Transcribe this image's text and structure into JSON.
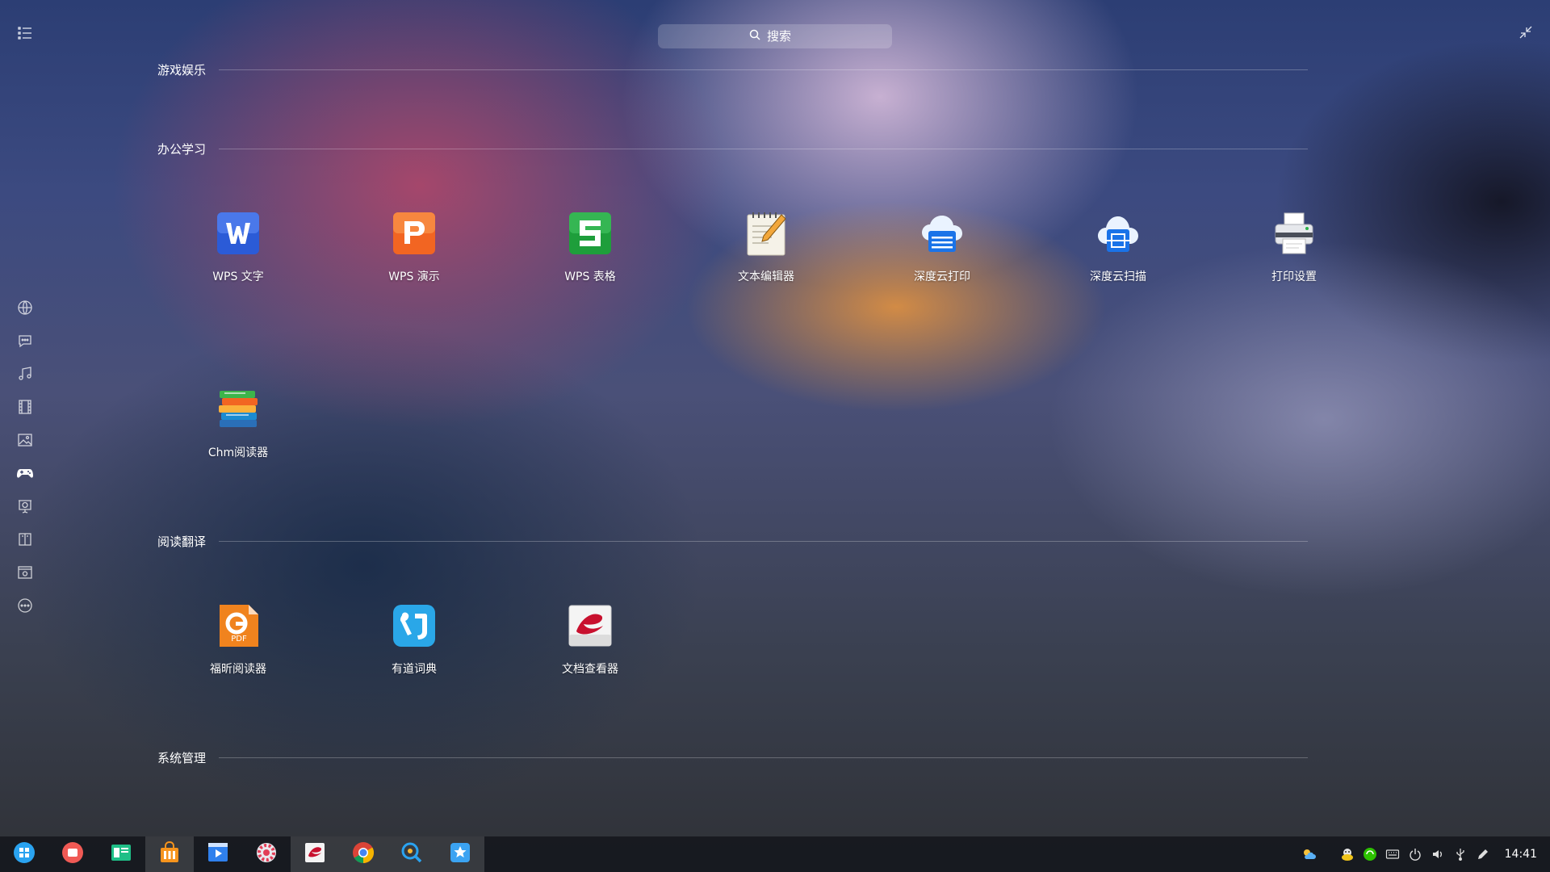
{
  "search": {
    "placeholder": "搜索"
  },
  "sidebar": {
    "categories": [
      {
        "icon": "internet-icon"
      },
      {
        "icon": "chat-icon"
      },
      {
        "icon": "music-icon"
      },
      {
        "icon": "video-icon"
      },
      {
        "icon": "image-icon"
      },
      {
        "icon": "game-icon",
        "active": true
      },
      {
        "icon": "education-icon"
      },
      {
        "icon": "reading-icon"
      },
      {
        "icon": "system-icon"
      },
      {
        "icon": "more-icon"
      }
    ]
  },
  "sections": {
    "games": {
      "title": "游戏娱乐"
    },
    "office": {
      "title": "办公学习",
      "apps": [
        {
          "label": "WPS 文字",
          "icon": "wps-writer-icon",
          "color": "#2b5bd7"
        },
        {
          "label": "WPS 演示",
          "icon": "wps-presentation-icon",
          "color": "#f26522"
        },
        {
          "label": "WPS 表格",
          "icon": "wps-spreadsheet-icon",
          "color": "#1e9e3b"
        },
        {
          "label": "文本编辑器",
          "icon": "text-editor-icon"
        },
        {
          "label": "深度云打印",
          "icon": "cloud-print-icon",
          "color": "#1a73e8"
        },
        {
          "label": "深度云扫描",
          "icon": "cloud-scan-icon",
          "color": "#1a73e8"
        },
        {
          "label": "打印设置",
          "icon": "printer-icon"
        },
        {
          "label": "Chm阅读器",
          "icon": "chm-reader-icon"
        }
      ]
    },
    "reading": {
      "title": "阅读翻译",
      "apps": [
        {
          "label": "福昕阅读器",
          "icon": "foxit-reader-icon",
          "color": "#f0831e"
        },
        {
          "label": "有道词典",
          "icon": "youdao-dict-icon",
          "color": "#2aa7e8"
        },
        {
          "label": "文档查看器",
          "icon": "document-viewer-icon",
          "color": "#c8102e"
        }
      ]
    },
    "system": {
      "title": "系统管理"
    }
  },
  "dock": {
    "apps": [
      {
        "icon": "launcher-icon"
      },
      {
        "icon": "screen-recorder-icon"
      },
      {
        "icon": "file-manager-icon"
      },
      {
        "icon": "app-store-icon",
        "running": true
      },
      {
        "icon": "movie-player-icon"
      },
      {
        "icon": "settings-icon"
      },
      {
        "icon": "document-viewer-dock-icon",
        "running": true
      },
      {
        "icon": "chrome-icon",
        "running": true
      },
      {
        "icon": "search-app-icon",
        "running": true
      },
      {
        "icon": "deepin-app-icon",
        "running": true
      }
    ]
  },
  "tray": {
    "icons": [
      "weather-icon",
      "chat-tray-icon",
      "wechat-tray-icon",
      "keyboard-icon",
      "power-icon",
      "volume-icon",
      "usb-icon",
      "edit-icon"
    ],
    "time": "14:41"
  }
}
